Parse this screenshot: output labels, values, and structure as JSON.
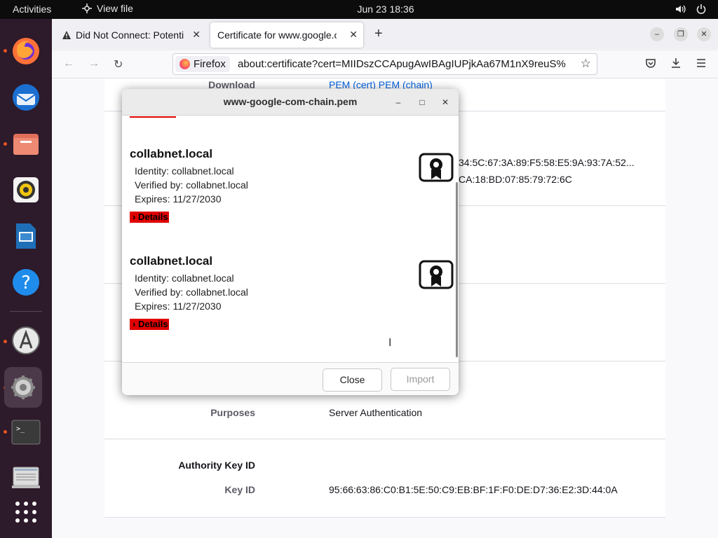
{
  "topbar": {
    "activities": "Activities",
    "app_menu": "View file",
    "clock": "Jun 23  18:36"
  },
  "firefox": {
    "tabs": [
      {
        "label": "Did Not Connect: Potenti"
      },
      {
        "label": "Certificate for www.google.c"
      }
    ],
    "identity_label": "Firefox",
    "url": "about:certificate?cert=MIIDszCCApugAwIBAgIUPjkAa67M1nX9reuS%"
  },
  "page": {
    "download_label": "Download",
    "download_links": [
      "PEM (cert)",
      "PEM (chain)"
    ],
    "fingerprint_line1": "34:5C:67:3A:89:F5:58:E5:9A:93:7A:52...",
    "fingerprint_line2": "CA:18:BD:07:85:79:72:6C",
    "purposes_label": "Purposes",
    "purposes_value": "Server Authentication",
    "authority_key_id_title": "Authority Key ID",
    "key_id_label": "Key ID",
    "key_id_value": "95:66:63:86:C0:B1:5E:50:C9:EB:BF:1F:F0:DE:D7:36:E2:3D:44:0A"
  },
  "dialog": {
    "title": "www-google-com-chain.pem",
    "certs": [
      {
        "name": "collabnet.local",
        "identity": "Identity: collabnet.local",
        "verified_by": "Verified by: collabnet.local",
        "expires": "Expires: 11/27/2030",
        "details_label": "Details"
      },
      {
        "name": "collabnet.local",
        "identity": "Identity: collabnet.local",
        "verified_by": "Verified by: collabnet.local",
        "expires": "Expires: 11/27/2030",
        "details_label": "Details"
      }
    ],
    "close_label": "Close",
    "import_label": "Import"
  },
  "colors": {
    "details_bg": "#e00000",
    "dock_bg": "#2d1a2a",
    "link": "#0060df"
  }
}
